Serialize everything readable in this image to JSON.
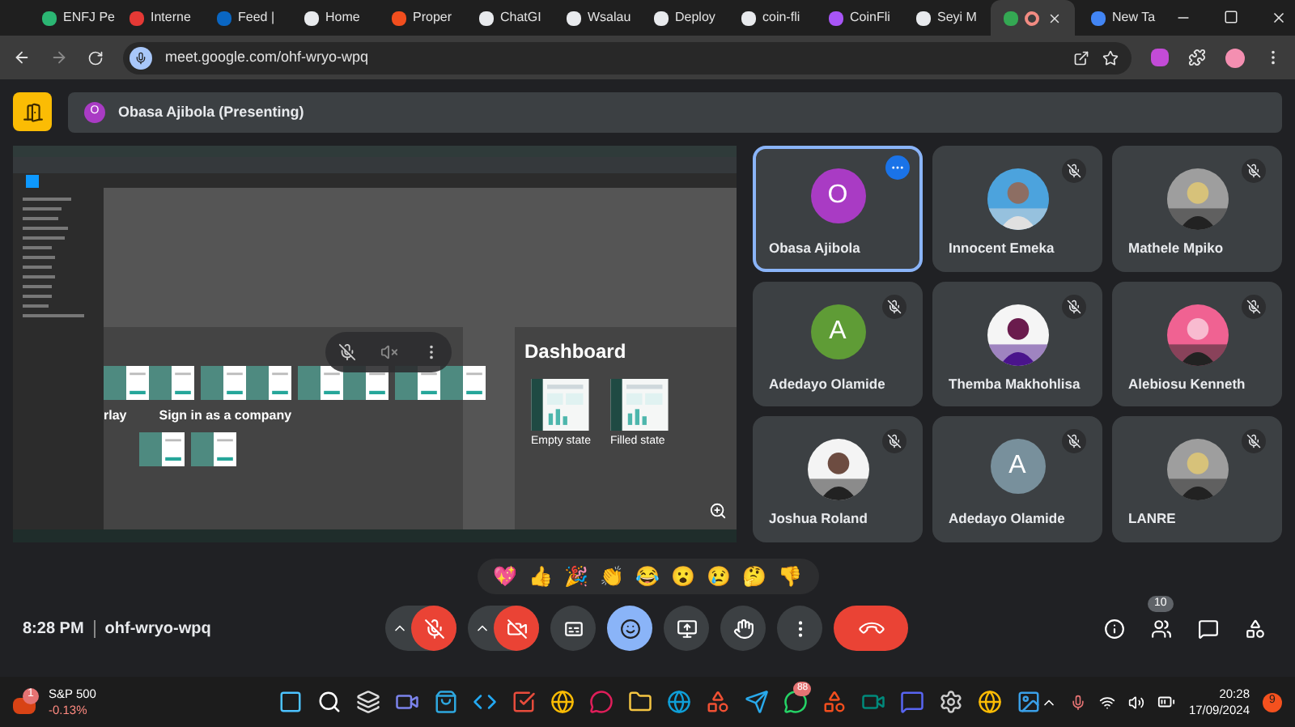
{
  "browser": {
    "tabs": [
      {
        "title": "ENFJ Pe",
        "selected": false
      },
      {
        "title": "Interne",
        "selected": false
      },
      {
        "title": "Feed |",
        "selected": false
      },
      {
        "title": "Home",
        "selected": false
      },
      {
        "title": "Proper",
        "selected": false
      },
      {
        "title": "ChatGI",
        "selected": false
      },
      {
        "title": "Wsalau",
        "selected": false
      },
      {
        "title": "Deploy",
        "selected": false
      },
      {
        "title": "coin-fli",
        "selected": false
      },
      {
        "title": "CoinFli",
        "selected": false
      },
      {
        "title": "Seyi M",
        "selected": false
      },
      {
        "selected": true,
        "recording": true
      },
      {
        "title": "New Ta",
        "selected": false
      }
    ],
    "url": "meet.google.com/ohf-wryo-wpq"
  },
  "presenter_bar": {
    "avatar_letter": "O",
    "label": "Obasa Ajibola (Presenting)"
  },
  "shared_screen": {
    "frame_title": "Dashboard",
    "thumbnails": [
      {
        "caption": "Empty state"
      },
      {
        "caption": "Filled state"
      }
    ],
    "section_title": "Sign in as a company",
    "cut_title": "rlay"
  },
  "participants": [
    {
      "name": "Obasa Ajibola",
      "avatar": {
        "kind": "letter",
        "letter": "O",
        "color": "#a93bc4"
      },
      "muted": false,
      "selected": true
    },
    {
      "name": "Innocent Emeka",
      "muted": true,
      "selected": false
    },
    {
      "name": "Mathele Mpiko",
      "muted": true,
      "selected": false
    },
    {
      "name": "Adedayo Olamide",
      "avatar": {
        "kind": "letter",
        "letter": "A",
        "color": "#5f9c36"
      },
      "muted": true,
      "selected": false
    },
    {
      "name": "Themba Makhohlisa",
      "muted": true,
      "selected": false
    },
    {
      "name": "Alebiosu Kenneth",
      "muted": true,
      "selected": false
    },
    {
      "name": "Joshua Roland",
      "muted": true,
      "selected": false
    },
    {
      "name": "Adedayo Olamide",
      "avatar": {
        "kind": "letter",
        "letter": "A",
        "color": "#78909c"
      },
      "muted": true,
      "selected": false
    },
    {
      "name": "LANRE",
      "muted": true,
      "selected": false
    }
  ],
  "reactions": [
    "💖",
    "👍",
    "🎉",
    "👏",
    "😂",
    "😮",
    "😢",
    "🤔",
    "👎"
  ],
  "meeting_info": {
    "time": "8:28 PM",
    "code": "ohf-wryo-wpq"
  },
  "controls": [
    {
      "kind": "mic",
      "on": false
    },
    {
      "kind": "camera",
      "on": false
    },
    {
      "kind": "captions",
      "on": false
    },
    {
      "kind": "reactions",
      "on": true
    },
    {
      "kind": "present",
      "on": false
    },
    {
      "kind": "hand",
      "on": false
    },
    {
      "kind": "more",
      "on": false
    },
    {
      "kind": "leave",
      "on": false
    }
  ],
  "side_controls": {
    "people_count": "10"
  },
  "taskbar": {
    "widget": {
      "badge": "1",
      "title": "S&P 500",
      "change": "-0.13%"
    },
    "whatsapp_badge": "88",
    "time": "20:28",
    "date": "17/09/2024",
    "notifications": "9"
  }
}
